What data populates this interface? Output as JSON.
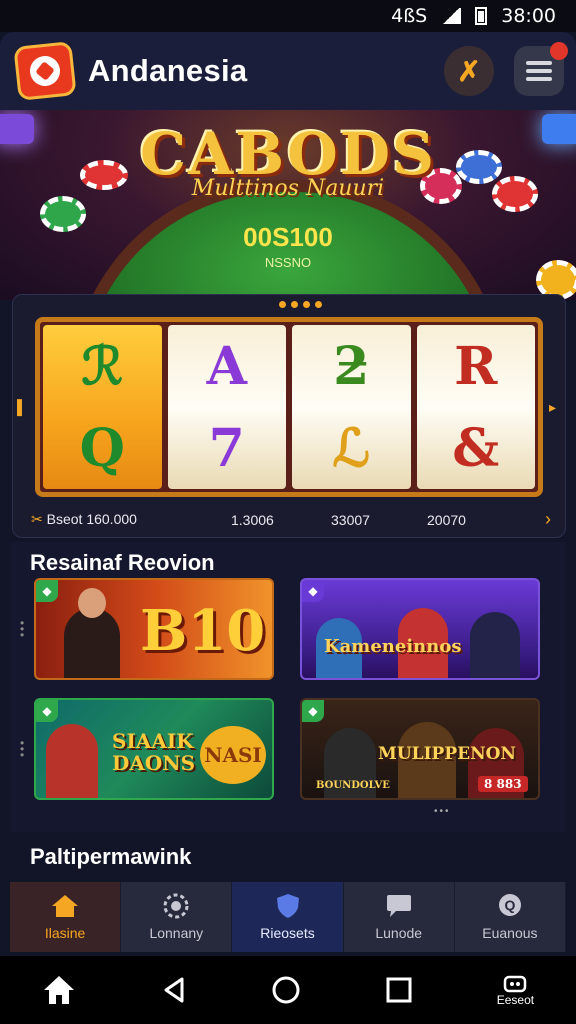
{
  "status_bar": {
    "network": "4ßS",
    "time": "38:00"
  },
  "header": {
    "title": "Andanesia",
    "tool_glyph": "✗",
    "icons": [
      "logo-icon",
      "tool-icon",
      "menu-icon"
    ]
  },
  "hero": {
    "title": "CABODS",
    "subtitle": "Multtinos Nauuri",
    "amount": "00S100",
    "label": "NSSNO"
  },
  "slot": {
    "reels": [
      [
        "ℛ",
        "Q"
      ],
      [
        "A",
        "7"
      ],
      [
        "ƻ",
        "ℒ"
      ],
      [
        "R",
        "&"
      ]
    ],
    "stats": {
      "left_label": "Bseot",
      "left_value": "160.000",
      "v2": "1.3006",
      "v3": "33007",
      "v4": "20070"
    }
  },
  "games_section": {
    "title": "Resainaf Reovion",
    "cards": [
      {
        "text": "B10",
        "badge": "◆"
      },
      {
        "text": "Kameneinnos",
        "badge": "◆"
      },
      {
        "text": "SIAAIK DAONS",
        "text2": "NASI",
        "badge": "◆"
      },
      {
        "text": "MULIPPENON",
        "text2": "BOUNDOLVE",
        "tag": "8 883",
        "badge": "◆"
      }
    ]
  },
  "section2": {
    "title": "Paltipermawink"
  },
  "bottom_nav": {
    "items": [
      {
        "label": "Ilasine",
        "icon": "home-icon"
      },
      {
        "label": "Lonnany",
        "icon": "chip-icon"
      },
      {
        "label": "Rieosets",
        "icon": "shield-icon"
      },
      {
        "label": "Lunode",
        "icon": "chat-icon"
      },
      {
        "label": "Euanous",
        "icon": "help-icon"
      }
    ]
  },
  "system_nav": {
    "extra_label": "Eeseot"
  },
  "colors": {
    "accent": "#f5a623",
    "background": "#121428",
    "header": "#1b1e3a"
  }
}
